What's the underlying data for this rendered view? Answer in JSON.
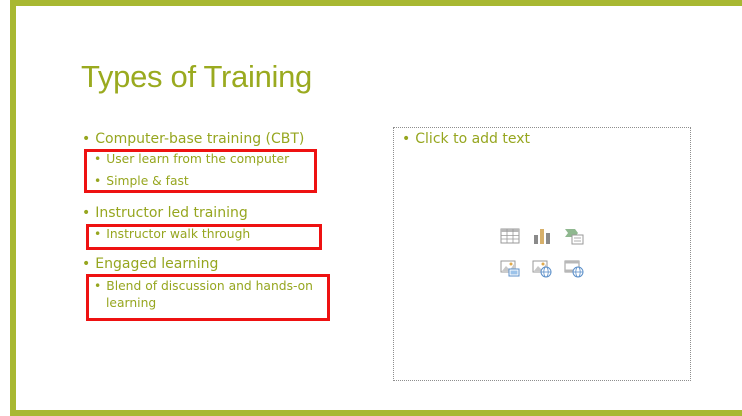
{
  "slide": {
    "title": "Types of Training",
    "bullets": [
      {
        "label": "Computer-base training (CBT)",
        "sub": [
          "User learn from the computer",
          "Simple & fast"
        ]
      },
      {
        "label": "Instructor led training",
        "sub": [
          "Instructor walk through"
        ]
      },
      {
        "label": "Engaged learning",
        "sub": [
          "Blend of discussion and hands-on",
          "learning"
        ]
      }
    ],
    "placeholder": {
      "prompt": "Click to add text",
      "icons": [
        "insert-table-icon",
        "insert-chart-icon",
        "insert-smartart-icon",
        "insert-picture-icon",
        "online-picture-icon",
        "insert-video-icon"
      ]
    }
  },
  "colors": {
    "accent": "#a8b832",
    "text": "#96a61f",
    "highlight": "#ee1111"
  }
}
